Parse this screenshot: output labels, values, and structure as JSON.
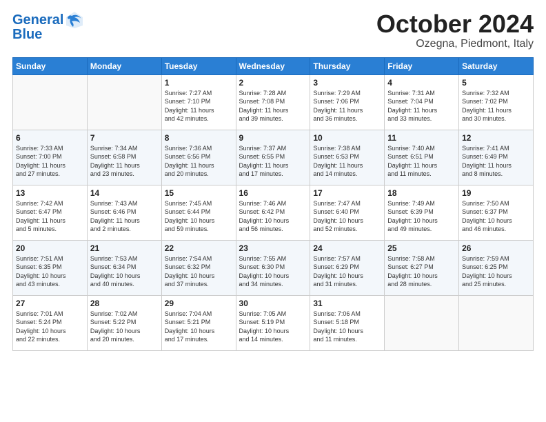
{
  "header": {
    "logo_line1": "General",
    "logo_line2": "Blue",
    "month": "October 2024",
    "location": "Ozegna, Piedmont, Italy"
  },
  "weekdays": [
    "Sunday",
    "Monday",
    "Tuesday",
    "Wednesday",
    "Thursday",
    "Friday",
    "Saturday"
  ],
  "weeks": [
    [
      {
        "day": "",
        "info": ""
      },
      {
        "day": "",
        "info": ""
      },
      {
        "day": "1",
        "info": "Sunrise: 7:27 AM\nSunset: 7:10 PM\nDaylight: 11 hours\nand 42 minutes."
      },
      {
        "day": "2",
        "info": "Sunrise: 7:28 AM\nSunset: 7:08 PM\nDaylight: 11 hours\nand 39 minutes."
      },
      {
        "day": "3",
        "info": "Sunrise: 7:29 AM\nSunset: 7:06 PM\nDaylight: 11 hours\nand 36 minutes."
      },
      {
        "day": "4",
        "info": "Sunrise: 7:31 AM\nSunset: 7:04 PM\nDaylight: 11 hours\nand 33 minutes."
      },
      {
        "day": "5",
        "info": "Sunrise: 7:32 AM\nSunset: 7:02 PM\nDaylight: 11 hours\nand 30 minutes."
      }
    ],
    [
      {
        "day": "6",
        "info": "Sunrise: 7:33 AM\nSunset: 7:00 PM\nDaylight: 11 hours\nand 27 minutes."
      },
      {
        "day": "7",
        "info": "Sunrise: 7:34 AM\nSunset: 6:58 PM\nDaylight: 11 hours\nand 23 minutes."
      },
      {
        "day": "8",
        "info": "Sunrise: 7:36 AM\nSunset: 6:56 PM\nDaylight: 11 hours\nand 20 minutes."
      },
      {
        "day": "9",
        "info": "Sunrise: 7:37 AM\nSunset: 6:55 PM\nDaylight: 11 hours\nand 17 minutes."
      },
      {
        "day": "10",
        "info": "Sunrise: 7:38 AM\nSunset: 6:53 PM\nDaylight: 11 hours\nand 14 minutes."
      },
      {
        "day": "11",
        "info": "Sunrise: 7:40 AM\nSunset: 6:51 PM\nDaylight: 11 hours\nand 11 minutes."
      },
      {
        "day": "12",
        "info": "Sunrise: 7:41 AM\nSunset: 6:49 PM\nDaylight: 11 hours\nand 8 minutes."
      }
    ],
    [
      {
        "day": "13",
        "info": "Sunrise: 7:42 AM\nSunset: 6:47 PM\nDaylight: 11 hours\nand 5 minutes."
      },
      {
        "day": "14",
        "info": "Sunrise: 7:43 AM\nSunset: 6:46 PM\nDaylight: 11 hours\nand 2 minutes."
      },
      {
        "day": "15",
        "info": "Sunrise: 7:45 AM\nSunset: 6:44 PM\nDaylight: 10 hours\nand 59 minutes."
      },
      {
        "day": "16",
        "info": "Sunrise: 7:46 AM\nSunset: 6:42 PM\nDaylight: 10 hours\nand 56 minutes."
      },
      {
        "day": "17",
        "info": "Sunrise: 7:47 AM\nSunset: 6:40 PM\nDaylight: 10 hours\nand 52 minutes."
      },
      {
        "day": "18",
        "info": "Sunrise: 7:49 AM\nSunset: 6:39 PM\nDaylight: 10 hours\nand 49 minutes."
      },
      {
        "day": "19",
        "info": "Sunrise: 7:50 AM\nSunset: 6:37 PM\nDaylight: 10 hours\nand 46 minutes."
      }
    ],
    [
      {
        "day": "20",
        "info": "Sunrise: 7:51 AM\nSunset: 6:35 PM\nDaylight: 10 hours\nand 43 minutes."
      },
      {
        "day": "21",
        "info": "Sunrise: 7:53 AM\nSunset: 6:34 PM\nDaylight: 10 hours\nand 40 minutes."
      },
      {
        "day": "22",
        "info": "Sunrise: 7:54 AM\nSunset: 6:32 PM\nDaylight: 10 hours\nand 37 minutes."
      },
      {
        "day": "23",
        "info": "Sunrise: 7:55 AM\nSunset: 6:30 PM\nDaylight: 10 hours\nand 34 minutes."
      },
      {
        "day": "24",
        "info": "Sunrise: 7:57 AM\nSunset: 6:29 PM\nDaylight: 10 hours\nand 31 minutes."
      },
      {
        "day": "25",
        "info": "Sunrise: 7:58 AM\nSunset: 6:27 PM\nDaylight: 10 hours\nand 28 minutes."
      },
      {
        "day": "26",
        "info": "Sunrise: 7:59 AM\nSunset: 6:25 PM\nDaylight: 10 hours\nand 25 minutes."
      }
    ],
    [
      {
        "day": "27",
        "info": "Sunrise: 7:01 AM\nSunset: 5:24 PM\nDaylight: 10 hours\nand 22 minutes."
      },
      {
        "day": "28",
        "info": "Sunrise: 7:02 AM\nSunset: 5:22 PM\nDaylight: 10 hours\nand 20 minutes."
      },
      {
        "day": "29",
        "info": "Sunrise: 7:04 AM\nSunset: 5:21 PM\nDaylight: 10 hours\nand 17 minutes."
      },
      {
        "day": "30",
        "info": "Sunrise: 7:05 AM\nSunset: 5:19 PM\nDaylight: 10 hours\nand 14 minutes."
      },
      {
        "day": "31",
        "info": "Sunrise: 7:06 AM\nSunset: 5:18 PM\nDaylight: 10 hours\nand 11 minutes."
      },
      {
        "day": "",
        "info": ""
      },
      {
        "day": "",
        "info": ""
      }
    ]
  ]
}
